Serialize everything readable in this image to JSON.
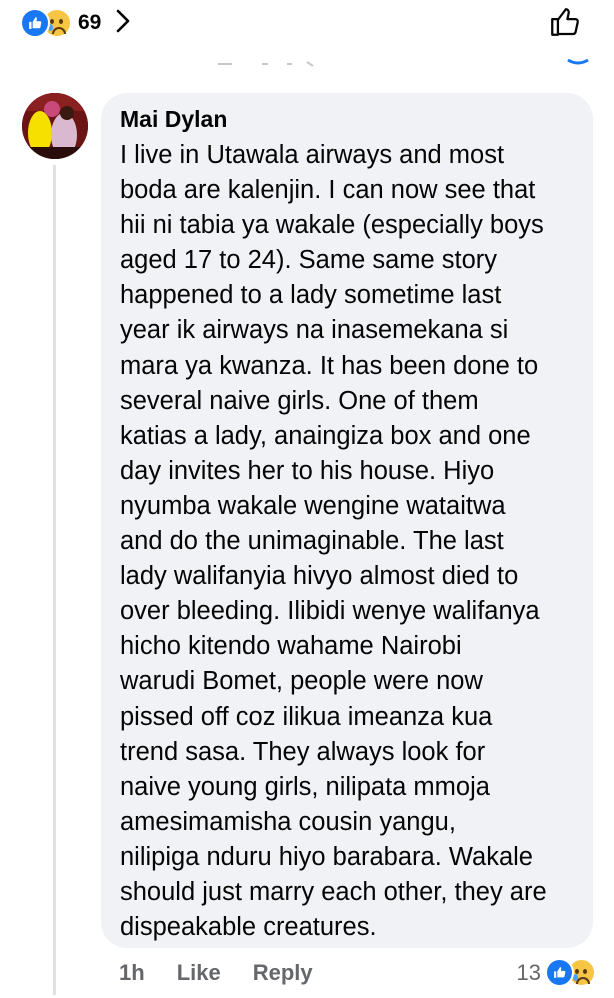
{
  "top_bar": {
    "reaction_count": "69",
    "reaction_icons": [
      "like-icon",
      "sad-icon"
    ],
    "chevron_icon": "chevron-right-icon",
    "like_icon": "thumbs-up-outline-icon"
  },
  "comment": {
    "author": "Mai Dylan",
    "text": "I live in Utawala airways and most\nboda are kalenjin. I can now see that\nhii ni tabia ya wakale (especially boys\naged 17 to 24). Same same story\nhappened to a lady sometime last\nyear ik airways na inasemekana si\nmara ya kwanza. It has been done to\nseveral naive girls. One of them\nkatias a lady, anaingiza box and one\nday invites her to his house. Hiyo\nnyumba wakale wengine wataitwa\nand do the unimaginable. The last\nlady walifanyia hivyo almost died to\nover bleeding. Ilibidi wenye walifanya\nhicho kitendo wahame Nairobi\nwarudi Bomet, people were now\npissed off coz ilikua imeanza kua\ntrend sasa. They always look for\nnaive young girls, nilipata mmoja\namesimamisha cousin yangu,\nnilipiga nduru hiyo barabara. Wakale\nshould just marry each other, they are\ndispeakable creatures.",
    "time": "1h",
    "like_label": "Like",
    "reply_label": "Reply",
    "reaction_count": "13",
    "reaction_icons": [
      "like-icon",
      "sad-icon"
    ]
  },
  "colors": {
    "bubble": "#f0f2f5",
    "accent_blue": "#1877f2",
    "secondary_text": "#65676b",
    "sad_yellow": "#f7c544"
  }
}
